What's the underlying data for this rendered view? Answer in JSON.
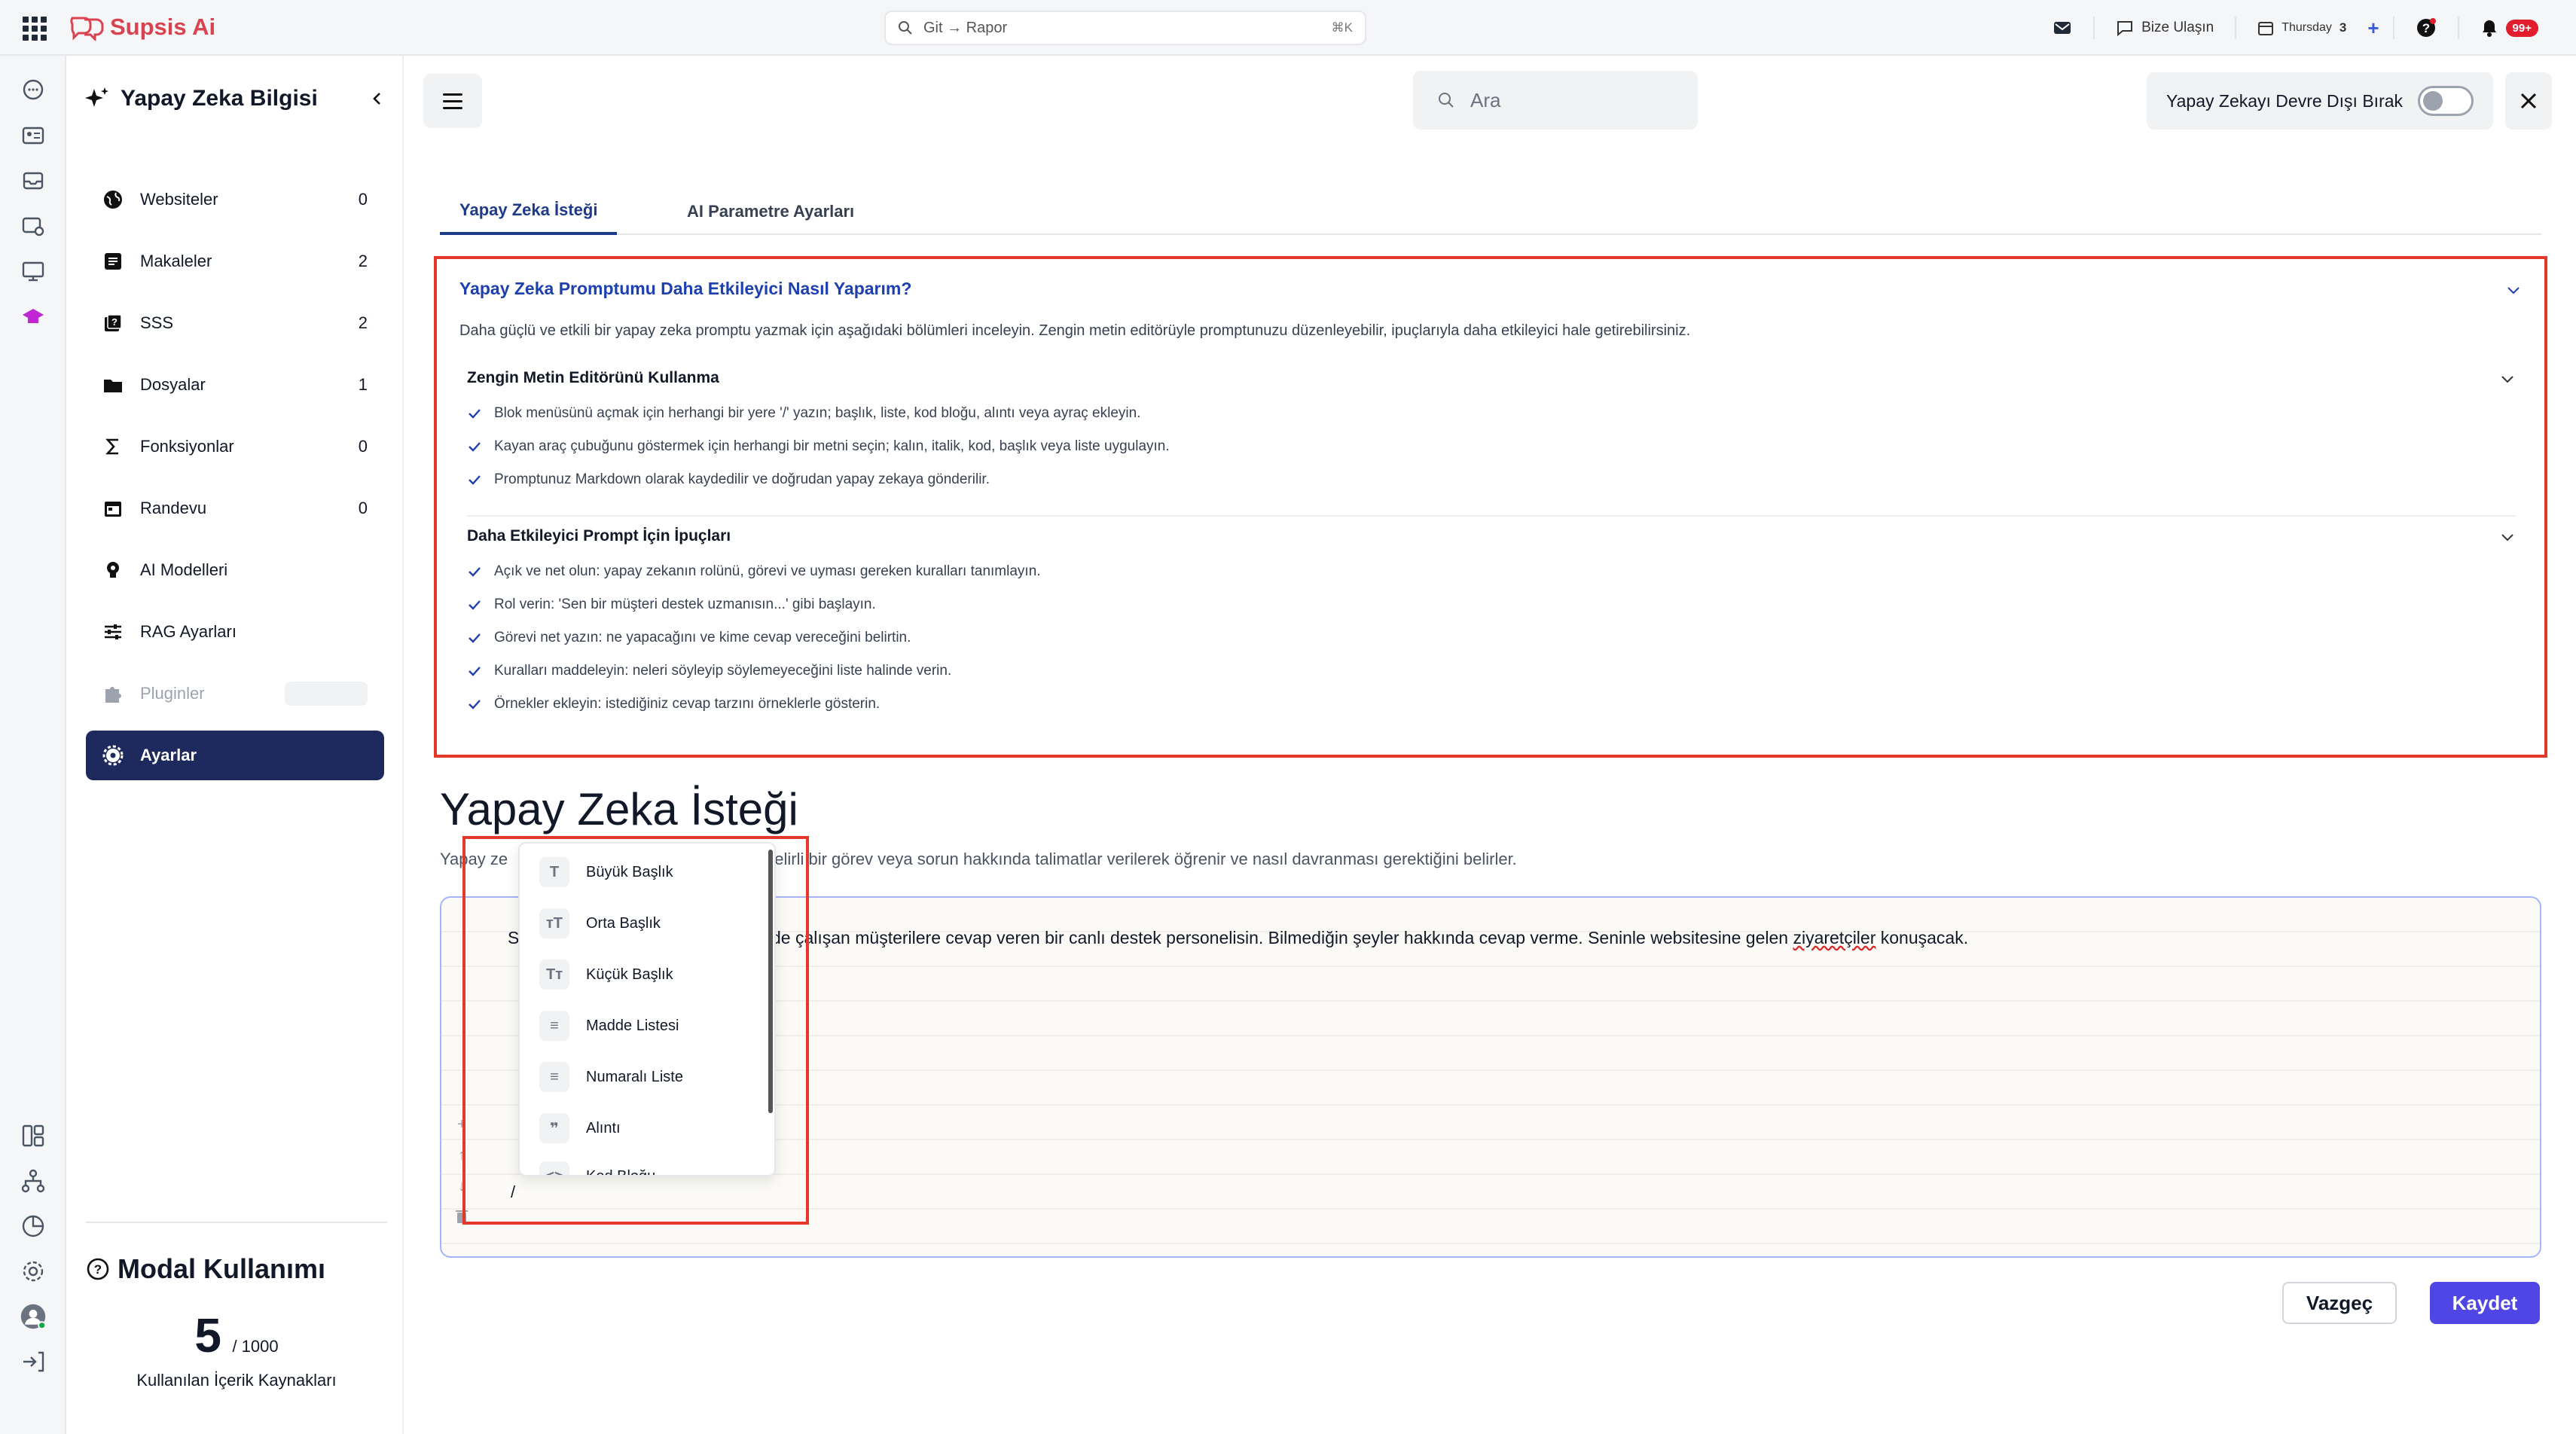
{
  "topbar": {
    "brand": "Supsis Ai",
    "search_text": "Git → Rapor",
    "search_shortcut": "⌘K",
    "contact_label": "Bize Ulaşın",
    "date_day": "Thursday",
    "date_num": "3",
    "notif_badge": "99+"
  },
  "sidebar": {
    "title": "Yapay Zeka Bilgisi",
    "items": [
      {
        "label": "Websiteler",
        "count": "0"
      },
      {
        "label": "Makaleler",
        "count": "2"
      },
      {
        "label": "SSS",
        "count": "2"
      },
      {
        "label": "Dosyalar",
        "count": "1"
      },
      {
        "label": "Fonksiyonlar",
        "count": "0"
      },
      {
        "label": "Randevu",
        "count": "0"
      },
      {
        "label": "AI Modelleri",
        "count": ""
      },
      {
        "label": "RAG Ayarları",
        "count": ""
      },
      {
        "label": "Pluginler",
        "count": ""
      },
      {
        "label": "Ayarlar",
        "count": ""
      }
    ],
    "usage": {
      "title": "Modal Kullanımı",
      "used": "5",
      "total": "/ 1000",
      "caption": "Kullanılan İçerik Kaynakları"
    }
  },
  "header": {
    "search_placeholder": "Ara",
    "toggle_label": "Yapay Zekayı Devre Dışı Bırak",
    "toggle_on": false
  },
  "tabs": [
    {
      "label": "Yapay Zeka İsteği",
      "active": true
    },
    {
      "label": "AI Parametre Ayarları",
      "active": false
    }
  ],
  "tips": {
    "title": "Yapay Zeka Promptumu Daha Etkileyici Nasıl Yaparım?",
    "description": "Daha güçlü ve etkili bir yapay zeka promptu yazmak için aşağıdaki bölümleri inceleyin. Zengin metin editörüyle promptunuzu düzenleyebilir, ipuçlarıyla daha etkileyici hale getirebilirsiniz.",
    "sections": [
      {
        "title": "Zengin Metin Editörünü Kullanma",
        "items": [
          "Blok menüsünü açmak için herhangi bir yere '/' yazın; başlık, liste, kod bloğu, alıntı veya ayraç ekleyin.",
          "Kayan araç çubuğunu göstermek için herhangi bir metni seçin; kalın, italik, kod, başlık veya liste uygulayın.",
          "Promptunuz Markdown olarak kaydedilir ve doğrudan yapay zekaya gönderilir."
        ]
      },
      {
        "title": "Daha Etkileyici Prompt İçin İpuçları",
        "items": [
          "Açık ve net olun: yapay zekanın rolünü, görevi ve uyması gereken kuralları tanımlayın.",
          "Rol verin: 'Sen bir müşteri destek uzmanısın...' gibi başlayın.",
          "Görevi net yazın: ne yapacağını ve kime cevap vereceğini belirtin.",
          "Kuralları maddeleyin: neleri söyleyip söylemeyeceğini liste halinde verin.",
          "Örnekler ekleyin: istediğiniz cevap tarzını örneklerle gösterin."
        ]
      }
    ]
  },
  "editor": {
    "heading": "Yapay Zeka İsteği",
    "sub_prefix": "Yapay ze",
    "sub_rest": "belirli bir görev veya sorun hakkında talimatlar verilerek öğrenir ve nasıl davranması gerektiğini belirler.",
    "content_prefix": "S",
    "content_rest": "de çalışan müşterilere cevap veren bir canlı destek personelisin. Bilmediğin şeyler hakkında cevap verme. Seninle websitesine gelen",
    "content_misspelled": "ziyaretçiler",
    "content_end": "konuşacak.",
    "slash": "/",
    "slash_menu": [
      {
        "icon": "T",
        "label": "Büyük Başlık"
      },
      {
        "icon": "тT",
        "label": "Orta Başlık"
      },
      {
        "icon": "Tт",
        "label": "Küçük Başlık"
      },
      {
        "icon": "≡",
        "label": "Madde Listesi"
      },
      {
        "icon": "≡",
        "label": "Numaralı Liste"
      },
      {
        "icon": "❞",
        "label": "Alıntı"
      },
      {
        "icon": "<>",
        "label": "Kod Bloğu"
      }
    ]
  },
  "actions": {
    "cancel": "Vazgeç",
    "save": "Kaydet"
  },
  "colors": {
    "brand": "#d9434f",
    "active_nav": "#1e2a5e",
    "primary_button": "#4f46e5",
    "highlight_border": "#e2392b",
    "tab_active": "#1e3a8a"
  }
}
